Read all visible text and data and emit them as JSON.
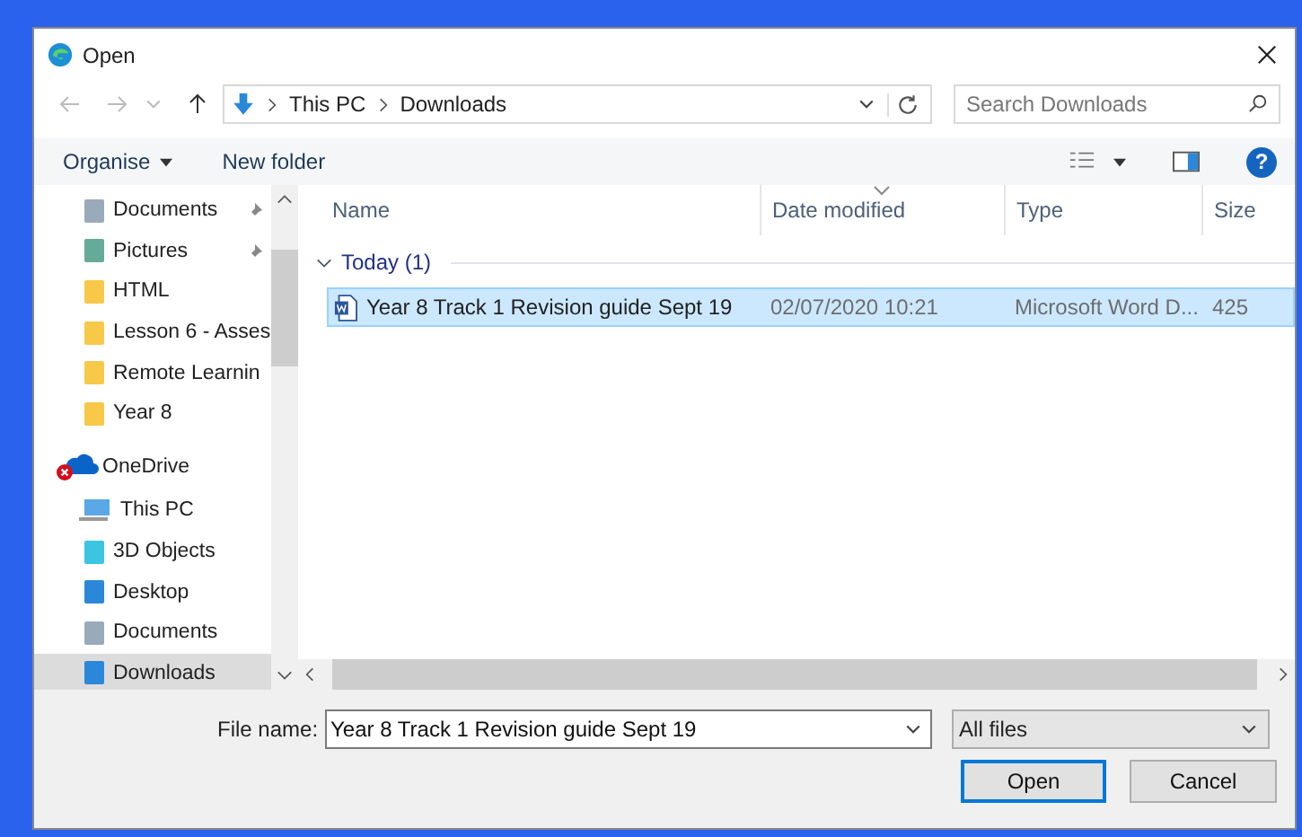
{
  "window": {
    "title": "Open"
  },
  "address": {
    "path": [
      {
        "label": "This PC"
      },
      {
        "label": "Downloads"
      }
    ],
    "search_placeholder": "Search Downloads"
  },
  "toolbar": {
    "organise": "Organise",
    "new_folder": "New folder",
    "help": "?"
  },
  "sidebar": {
    "quick_access": [
      {
        "label": "Documents",
        "kind": "document",
        "pinned": true,
        "selected": false
      },
      {
        "label": "Pictures",
        "kind": "picture",
        "pinned": true,
        "selected": false
      },
      {
        "label": "HTML",
        "kind": "folder",
        "pinned": false,
        "selected": false
      },
      {
        "label": "Lesson 6 - Asses",
        "kind": "folder",
        "pinned": false,
        "selected": false
      },
      {
        "label": "Remote Learnin",
        "kind": "folder",
        "pinned": false,
        "selected": false
      },
      {
        "label": "Year 8",
        "kind": "folder",
        "pinned": false,
        "selected": false
      }
    ],
    "roots": [
      {
        "label": "OneDrive",
        "kind": "cloud",
        "selected": false
      },
      {
        "label": "This PC",
        "kind": "computer",
        "selected": false,
        "children": [
          {
            "label": "3D Objects",
            "kind": "cube",
            "selected": false
          },
          {
            "label": "Desktop",
            "kind": "desktop",
            "selected": false
          },
          {
            "label": "Documents",
            "kind": "document",
            "selected": false
          },
          {
            "label": "Downloads",
            "kind": "download",
            "selected": true
          }
        ]
      }
    ]
  },
  "table": {
    "columns": [
      "Name",
      "Date modified",
      "Type",
      "Size"
    ],
    "groups": [
      {
        "label": "Today (1)",
        "expanded": true,
        "rows": [
          {
            "name": "Year 8 Track 1 Revision guide Sept 19",
            "date": "02/07/2020 10:21",
            "type": "Microsoft Word D...",
            "size": "425",
            "selected": true
          }
        ]
      }
    ]
  },
  "footer": {
    "file_name_label": "File name:",
    "file_name": "Year 8 Track 1 Revision guide Sept 19",
    "filter": "All files",
    "buttons": [
      "Open",
      "Cancel"
    ]
  }
}
